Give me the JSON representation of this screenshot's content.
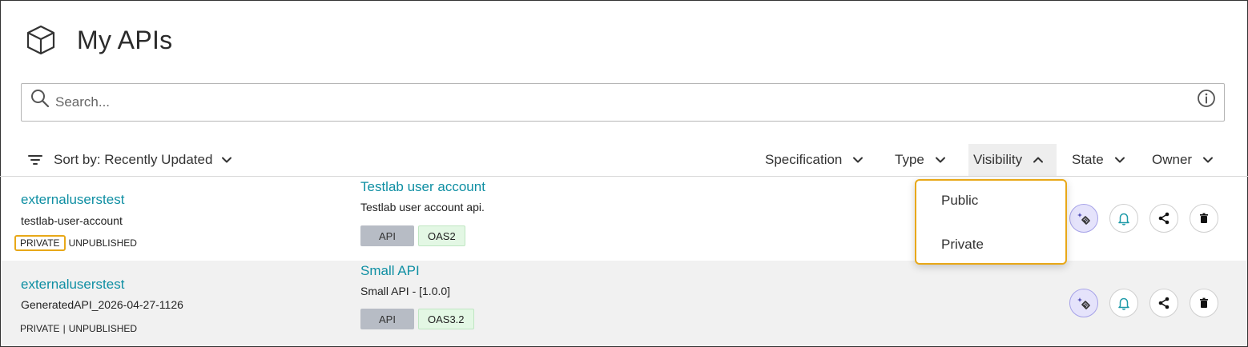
{
  "page": {
    "title": "My APIs",
    "icon": "cube-icon"
  },
  "search": {
    "placeholder": "Search...",
    "value": "",
    "search_icon": "search-icon",
    "info_icon": "info-icon"
  },
  "sort": {
    "label": "Sort by: Recently Updated",
    "icon": "filter-lines-icon"
  },
  "filters": [
    {
      "label": "Specification",
      "expanded": false
    },
    {
      "label": "Type",
      "expanded": false
    },
    {
      "label": "Visibility",
      "expanded": true
    },
    {
      "label": "State",
      "expanded": false
    },
    {
      "label": "Owner",
      "expanded": false
    }
  ],
  "visibility_menu": {
    "options": [
      "Public",
      "Private"
    ]
  },
  "rows": [
    {
      "owner": "externaluserstest",
      "slug": "testlab-user-account",
      "visibility": "PRIVATE",
      "state": "UNPUBLISHED",
      "api_name": "Testlab user account",
      "description": "Testlab user account api.",
      "type_tag": "API",
      "spec_tag": "OAS2"
    },
    {
      "owner": "externaluserstest",
      "slug": "GeneratedAPI_2026-04-27-1126",
      "visibility": "PRIVATE",
      "state": "UNPUBLISHED",
      "api_name": "Small API",
      "description": "Small API - [1.0.0]",
      "type_tag": "API",
      "spec_tag": "OAS3.2"
    }
  ],
  "row_actions": [
    "ai-assist-icon",
    "bell-icon",
    "share-icon",
    "trash-icon"
  ],
  "colors": {
    "link": "#0f8fa3",
    "highlight": "#e8a818",
    "api_tag": "#b7bcc5",
    "oas_tag": "#e3f7e4",
    "ai_button": "#e5e3fb"
  }
}
